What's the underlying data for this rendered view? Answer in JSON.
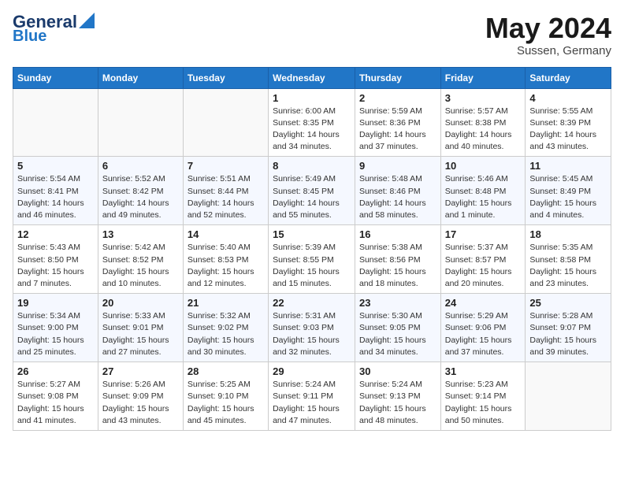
{
  "header": {
    "logo_line1": "General",
    "logo_line2": "Blue",
    "month_year": "May 2024",
    "location": "Sussen, Germany"
  },
  "days_of_week": [
    "Sunday",
    "Monday",
    "Tuesday",
    "Wednesday",
    "Thursday",
    "Friday",
    "Saturday"
  ],
  "weeks": [
    [
      {
        "day": "",
        "info": ""
      },
      {
        "day": "",
        "info": ""
      },
      {
        "day": "",
        "info": ""
      },
      {
        "day": "1",
        "info": "Sunrise: 6:00 AM\nSunset: 8:35 PM\nDaylight: 14 hours\nand 34 minutes."
      },
      {
        "day": "2",
        "info": "Sunrise: 5:59 AM\nSunset: 8:36 PM\nDaylight: 14 hours\nand 37 minutes."
      },
      {
        "day": "3",
        "info": "Sunrise: 5:57 AM\nSunset: 8:38 PM\nDaylight: 14 hours\nand 40 minutes."
      },
      {
        "day": "4",
        "info": "Sunrise: 5:55 AM\nSunset: 8:39 PM\nDaylight: 14 hours\nand 43 minutes."
      }
    ],
    [
      {
        "day": "5",
        "info": "Sunrise: 5:54 AM\nSunset: 8:41 PM\nDaylight: 14 hours\nand 46 minutes."
      },
      {
        "day": "6",
        "info": "Sunrise: 5:52 AM\nSunset: 8:42 PM\nDaylight: 14 hours\nand 49 minutes."
      },
      {
        "day": "7",
        "info": "Sunrise: 5:51 AM\nSunset: 8:44 PM\nDaylight: 14 hours\nand 52 minutes."
      },
      {
        "day": "8",
        "info": "Sunrise: 5:49 AM\nSunset: 8:45 PM\nDaylight: 14 hours\nand 55 minutes."
      },
      {
        "day": "9",
        "info": "Sunrise: 5:48 AM\nSunset: 8:46 PM\nDaylight: 14 hours\nand 58 minutes."
      },
      {
        "day": "10",
        "info": "Sunrise: 5:46 AM\nSunset: 8:48 PM\nDaylight: 15 hours\nand 1 minute."
      },
      {
        "day": "11",
        "info": "Sunrise: 5:45 AM\nSunset: 8:49 PM\nDaylight: 15 hours\nand 4 minutes."
      }
    ],
    [
      {
        "day": "12",
        "info": "Sunrise: 5:43 AM\nSunset: 8:50 PM\nDaylight: 15 hours\nand 7 minutes."
      },
      {
        "day": "13",
        "info": "Sunrise: 5:42 AM\nSunset: 8:52 PM\nDaylight: 15 hours\nand 10 minutes."
      },
      {
        "day": "14",
        "info": "Sunrise: 5:40 AM\nSunset: 8:53 PM\nDaylight: 15 hours\nand 12 minutes."
      },
      {
        "day": "15",
        "info": "Sunrise: 5:39 AM\nSunset: 8:55 PM\nDaylight: 15 hours\nand 15 minutes."
      },
      {
        "day": "16",
        "info": "Sunrise: 5:38 AM\nSunset: 8:56 PM\nDaylight: 15 hours\nand 18 minutes."
      },
      {
        "day": "17",
        "info": "Sunrise: 5:37 AM\nSunset: 8:57 PM\nDaylight: 15 hours\nand 20 minutes."
      },
      {
        "day": "18",
        "info": "Sunrise: 5:35 AM\nSunset: 8:58 PM\nDaylight: 15 hours\nand 23 minutes."
      }
    ],
    [
      {
        "day": "19",
        "info": "Sunrise: 5:34 AM\nSunset: 9:00 PM\nDaylight: 15 hours\nand 25 minutes."
      },
      {
        "day": "20",
        "info": "Sunrise: 5:33 AM\nSunset: 9:01 PM\nDaylight: 15 hours\nand 27 minutes."
      },
      {
        "day": "21",
        "info": "Sunrise: 5:32 AM\nSunset: 9:02 PM\nDaylight: 15 hours\nand 30 minutes."
      },
      {
        "day": "22",
        "info": "Sunrise: 5:31 AM\nSunset: 9:03 PM\nDaylight: 15 hours\nand 32 minutes."
      },
      {
        "day": "23",
        "info": "Sunrise: 5:30 AM\nSunset: 9:05 PM\nDaylight: 15 hours\nand 34 minutes."
      },
      {
        "day": "24",
        "info": "Sunrise: 5:29 AM\nSunset: 9:06 PM\nDaylight: 15 hours\nand 37 minutes."
      },
      {
        "day": "25",
        "info": "Sunrise: 5:28 AM\nSunset: 9:07 PM\nDaylight: 15 hours\nand 39 minutes."
      }
    ],
    [
      {
        "day": "26",
        "info": "Sunrise: 5:27 AM\nSunset: 9:08 PM\nDaylight: 15 hours\nand 41 minutes."
      },
      {
        "day": "27",
        "info": "Sunrise: 5:26 AM\nSunset: 9:09 PM\nDaylight: 15 hours\nand 43 minutes."
      },
      {
        "day": "28",
        "info": "Sunrise: 5:25 AM\nSunset: 9:10 PM\nDaylight: 15 hours\nand 45 minutes."
      },
      {
        "day": "29",
        "info": "Sunrise: 5:24 AM\nSunset: 9:11 PM\nDaylight: 15 hours\nand 47 minutes."
      },
      {
        "day": "30",
        "info": "Sunrise: 5:24 AM\nSunset: 9:13 PM\nDaylight: 15 hours\nand 48 minutes."
      },
      {
        "day": "31",
        "info": "Sunrise: 5:23 AM\nSunset: 9:14 PM\nDaylight: 15 hours\nand 50 minutes."
      },
      {
        "day": "",
        "info": ""
      }
    ]
  ]
}
